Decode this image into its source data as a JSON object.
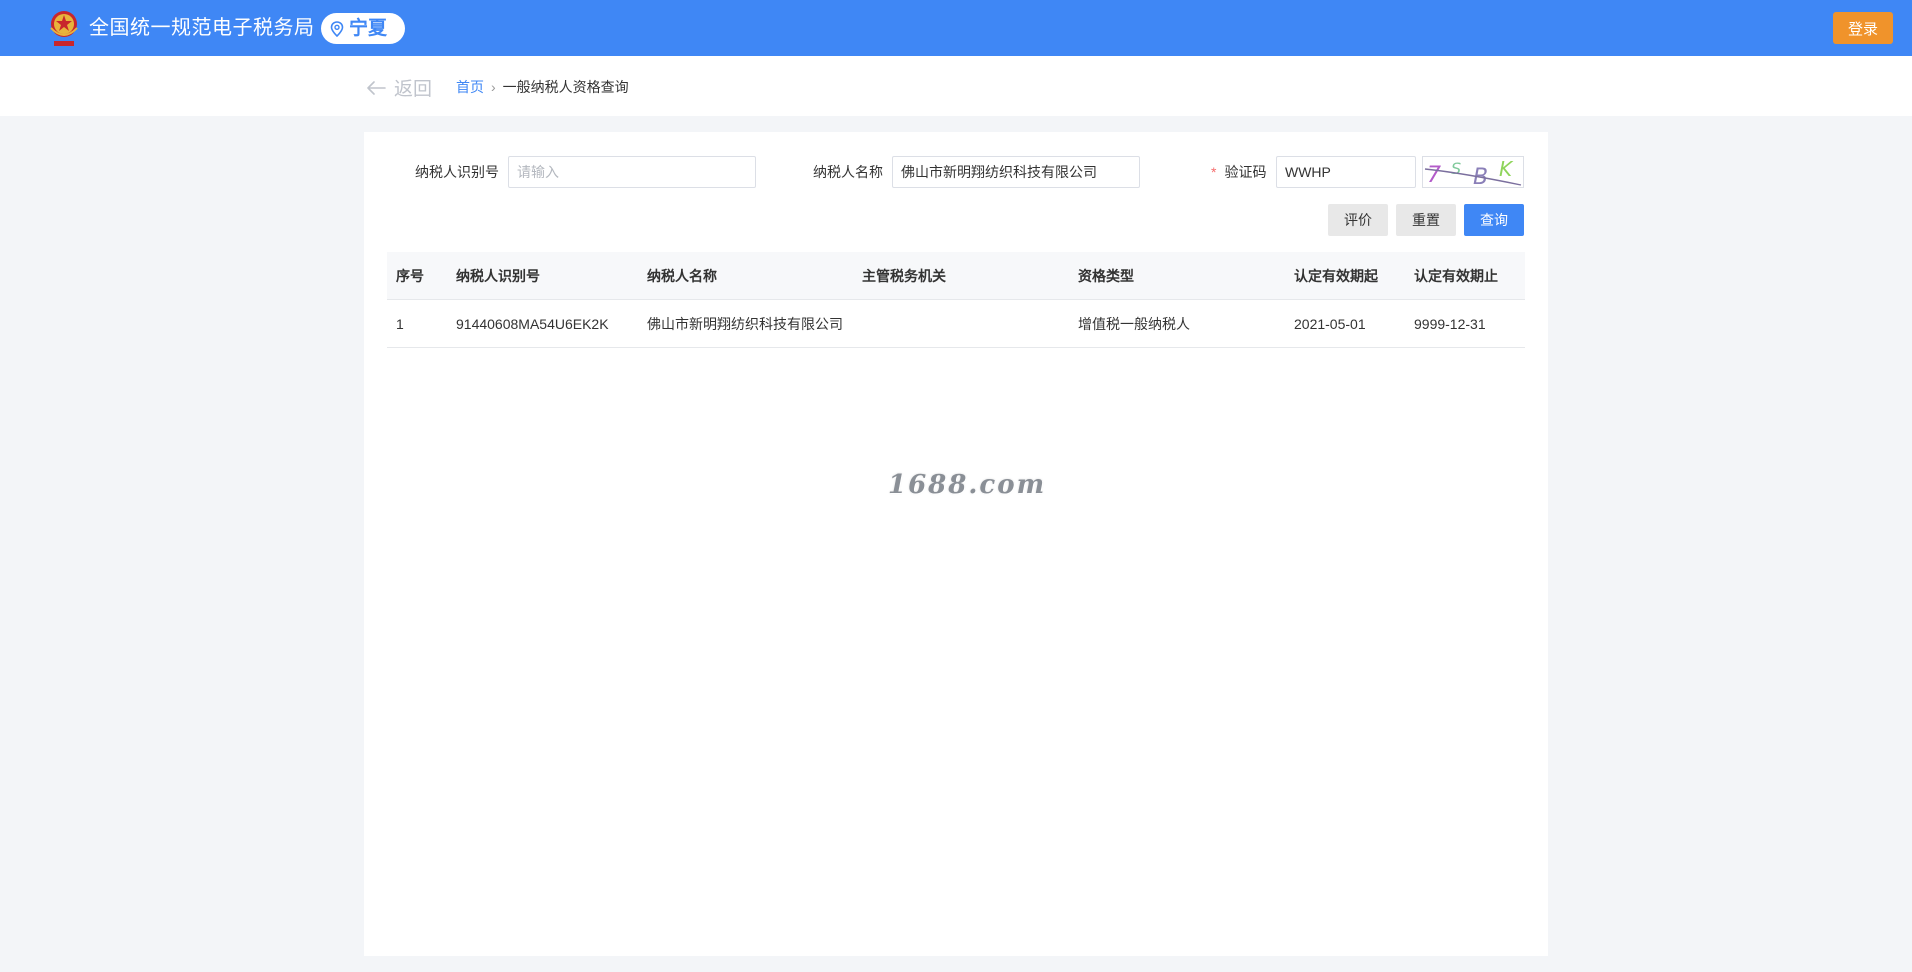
{
  "header": {
    "title": "全国统一规范电子税务局",
    "region": "宁夏",
    "login_label": "登录",
    "brand_color": "#3f87f5",
    "login_color": "#f0932b"
  },
  "breadcrumb": {
    "back_label": "返回",
    "home_label": "首页",
    "separator": "›",
    "current_label": "一般纳税人资格查询"
  },
  "form": {
    "taxpayer_id": {
      "label": "纳税人识别号",
      "value": "",
      "placeholder": "请输入"
    },
    "taxpayer_name": {
      "label": "纳税人名称",
      "value": "佛山市新明翔纺织科技有限公司",
      "placeholder": ""
    },
    "captcha": {
      "required_mark": "*",
      "label": "验证码",
      "value": "WWHP",
      "image_text": "7SBK"
    },
    "buttons": {
      "evaluate": "评价",
      "reset": "重置",
      "query": "查询"
    }
  },
  "table": {
    "columns": [
      "序号",
      "纳税人识别号",
      "纳税人名称",
      "主管税务机关",
      "资格类型",
      "认定有效期起",
      "认定有效期止"
    ],
    "rows": [
      [
        "1",
        "91440608MA54U6EK2K",
        "佛山市新明翔纺织科技有限公司",
        "",
        "增值税一般纳税人",
        "2021-05-01",
        "9999-12-31"
      ]
    ]
  },
  "watermark": "1688.com"
}
